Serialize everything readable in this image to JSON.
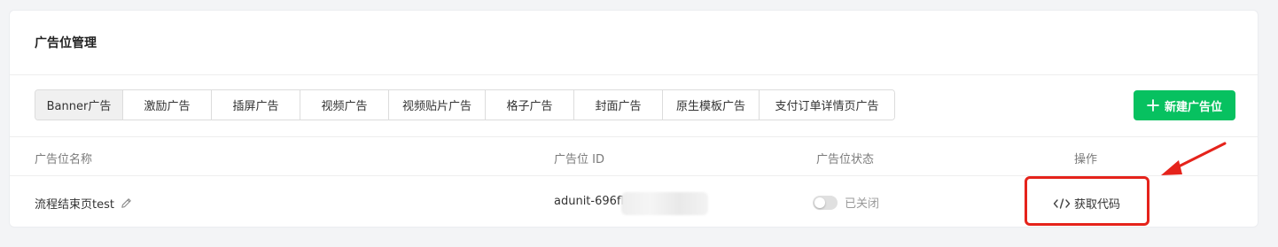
{
  "header": {
    "title": "广告位管理"
  },
  "tabs": [
    {
      "label": "Banner广告",
      "active": true
    },
    {
      "label": "激励广告"
    },
    {
      "label": "插屏广告"
    },
    {
      "label": "视频广告"
    },
    {
      "label": "视频贴片广告"
    },
    {
      "label": "格子广告"
    },
    {
      "label": "封面广告"
    },
    {
      "label": "原生模板广告"
    },
    {
      "label": "支付订单详情页广告"
    }
  ],
  "new_button": {
    "label": "新建广告位",
    "icon": "plus-icon"
  },
  "table": {
    "headers": {
      "name": "广告位名称",
      "id": "广告位 ID",
      "status": "广告位状态",
      "action": "操作"
    },
    "rows": [
      {
        "name": "流程结束页test",
        "edit_icon": "pencil-icon",
        "id": "adunit-696fl",
        "status": "已关闭",
        "enabled": false,
        "action": "获取代码",
        "action_icon": "code-icon"
      }
    ]
  },
  "colors": {
    "brand_green": "#07c160",
    "annotation_red": "#e5231b"
  }
}
